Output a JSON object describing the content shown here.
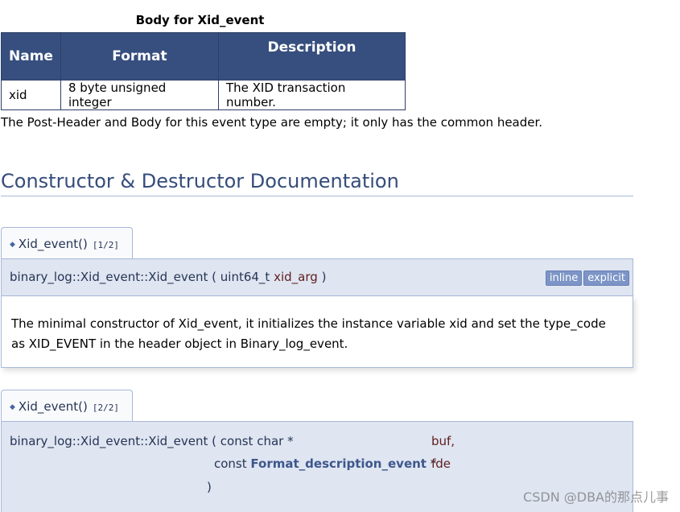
{
  "table": {
    "caption": "Body for Xid_event",
    "headers": [
      "Name",
      "Format",
      "Description"
    ],
    "rows": [
      [
        "xid",
        "8 byte unsigned integer",
        "The XID transaction number."
      ]
    ]
  },
  "paragraph": "The Post-Header and Body for this event type are empty; it only has the common header.",
  "section_title": "Constructor & Destructor Documentation",
  "member1": {
    "tab_name": "Xid_event()",
    "overload": "[1/2]",
    "proto_prefix": "binary_log::Xid_event::Xid_event ( uint64_t",
    "param": "xid_arg",
    "proto_suffix": ")",
    "badges": [
      "inline",
      "explicit"
    ],
    "doc": "The minimal constructor of Xid_event, it initializes the instance variable xid and set the type_code as XID_EVENT in the header object in Binary_log_event."
  },
  "member2": {
    "tab_name": "Xid_event()",
    "overload": "[2/2]",
    "proto_prefix": "binary_log::Xid_event::Xid_event (",
    "param1_type": "const char *",
    "param1_name": "buf,",
    "param2_type_prefix": "const",
    "param2_type_link": "Format_description_event",
    "param2_type_suffix": "*",
    "param2_name": "fde",
    "close_paren": ")"
  },
  "watermark": "CSDN @DBA的那点儿事"
}
